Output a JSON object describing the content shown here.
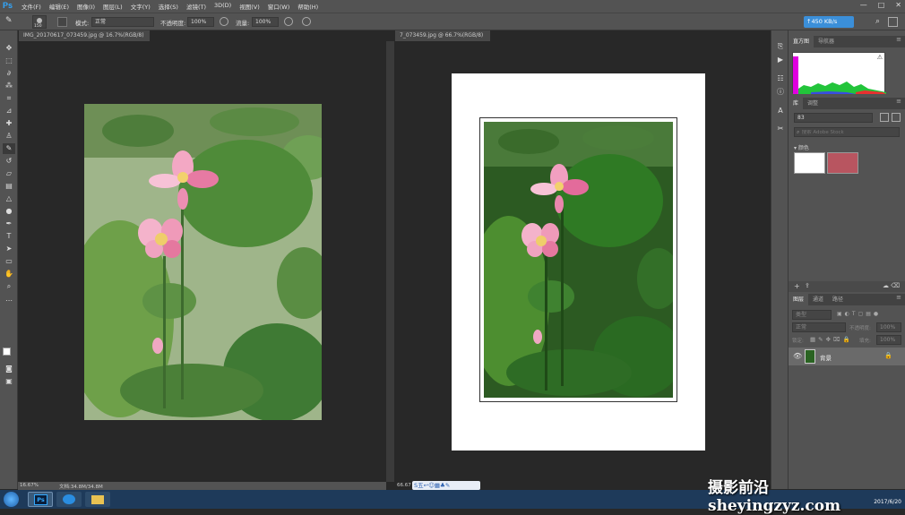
{
  "app": {
    "logo": "Ps"
  },
  "menu": [
    "文件(F)",
    "编辑(E)",
    "图像(I)",
    "图层(L)",
    "文字(Y)",
    "选择(S)",
    "滤镜(T)",
    "3D(D)",
    "视图(V)",
    "窗口(W)",
    "帮助(H)"
  ],
  "window_controls": {
    "minimize": "—",
    "restore": "□",
    "close": "✕"
  },
  "options": {
    "brush_size": "150",
    "mode_label": "模式:",
    "mode_value": "正常",
    "opacity_label": "不透明度:",
    "opacity_value": "100%",
    "flow_label": "流量:",
    "flow_value": "100%",
    "speed": "↑450 KB/s"
  },
  "documents": [
    {
      "tab": "IMG_20170617_073459.jpg @ 16.7%(RGB/8)",
      "close": "×",
      "zoom": "16.67%",
      "doc_info": "文档:34.8M/34.8M"
    },
    {
      "tab": "7_073459.jpg @ 66.7%(RGB/8)",
      "close": "×",
      "zoom": "66.67"
    }
  ],
  "panels": {
    "histogram": {
      "tabs": [
        "直方图",
        "导航器"
      ],
      "warning": "⚠"
    },
    "library": {
      "tabs": [
        "库",
        "调整"
      ],
      "dropdown": "83",
      "search_placeholder": "搜索 Adobe Stock",
      "group": "颜色",
      "swatches": [
        "#ffffff",
        "#b85560"
      ]
    },
    "layers": {
      "tabs": [
        "图层",
        "通道",
        "路径"
      ],
      "kind_placeholder": "类型",
      "mode": "正常",
      "opacity_label": "不透明度:",
      "opacity_value": "100%",
      "lock_label": "锁定:",
      "fill_label": "填充:",
      "fill_value": "100%",
      "layer_name": "背景"
    }
  },
  "taskbar": {
    "clock_time": "",
    "clock_date": "2017/6/20"
  },
  "watermark": "摄影前沿 sheyingzyz.com",
  "ime_bar": "S五↩☺▦♣✎"
}
